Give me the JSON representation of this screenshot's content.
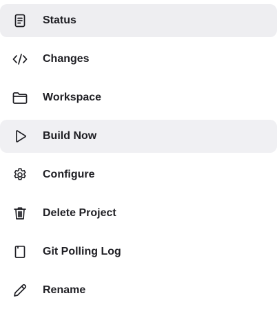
{
  "menu": {
    "items": [
      {
        "label": "Status",
        "icon": "document-icon",
        "state": "active"
      },
      {
        "label": "Changes",
        "icon": "code-icon",
        "state": "normal"
      },
      {
        "label": "Workspace",
        "icon": "folder-icon",
        "state": "normal"
      },
      {
        "label": "Build Now",
        "icon": "play-icon",
        "state": "hover"
      },
      {
        "label": "Configure",
        "icon": "gear-icon",
        "state": "normal"
      },
      {
        "label": "Delete Project",
        "icon": "trash-icon",
        "state": "normal"
      },
      {
        "label": "Git Polling Log",
        "icon": "cylinder-icon",
        "state": "normal"
      },
      {
        "label": "Rename",
        "icon": "pencil-icon",
        "state": "normal"
      }
    ]
  },
  "colors": {
    "active_bg": "#eeeef1",
    "hover_bg": "#f0f0f3",
    "text": "#1f1f24",
    "icon": "#1f1f24"
  }
}
